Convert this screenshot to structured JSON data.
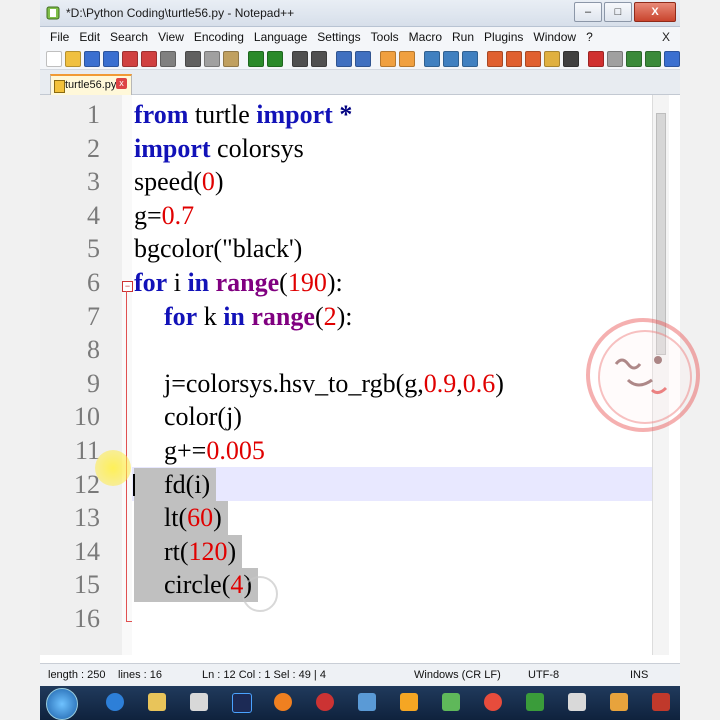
{
  "window": {
    "title": "*D:\\Python Coding\\turtle56.py - Notepad++",
    "min_label": "–",
    "max_label": "□",
    "close_label": "X"
  },
  "menu": {
    "items": [
      "File",
      "Edit",
      "Search",
      "View",
      "Encoding",
      "Language",
      "Settings",
      "Tools",
      "Macro",
      "Run",
      "Plugins",
      "Window",
      "?"
    ],
    "close": "X"
  },
  "tab": {
    "name": "turtle56.py",
    "close": "x"
  },
  "editor": {
    "lines": [
      {
        "n": "1",
        "indent": 0,
        "tokens": [
          {
            "t": "from",
            "c": "kw"
          },
          {
            "t": " turtle ",
            "c": ""
          },
          {
            "t": "import",
            "c": "kw"
          },
          {
            "t": " ",
            "c": ""
          },
          {
            "t": "*",
            "c": "op"
          }
        ]
      },
      {
        "n": "2",
        "indent": 0,
        "tokens": [
          {
            "t": "import",
            "c": "kw"
          },
          {
            "t": " colorsys",
            "c": ""
          }
        ]
      },
      {
        "n": "3",
        "indent": 0,
        "tokens": [
          {
            "t": "speed(",
            "c": ""
          },
          {
            "t": "0",
            "c": "num"
          },
          {
            "t": ")",
            "c": ""
          }
        ]
      },
      {
        "n": "4",
        "indent": 0,
        "tokens": [
          {
            "t": "g=",
            "c": ""
          },
          {
            "t": "0.7",
            "c": "num"
          }
        ]
      },
      {
        "n": "5",
        "indent": 0,
        "tokens": [
          {
            "t": "bgcolor(\"black')",
            "c": ""
          }
        ]
      },
      {
        "n": "6",
        "indent": 0,
        "tokens": [
          {
            "t": "for",
            "c": "kw"
          },
          {
            "t": " i ",
            "c": ""
          },
          {
            "t": "in",
            "c": "kw"
          },
          {
            "t": " ",
            "c": ""
          },
          {
            "t": "range",
            "c": "bi"
          },
          {
            "t": "(",
            "c": ""
          },
          {
            "t": "190",
            "c": "num"
          },
          {
            "t": "):",
            "c": ""
          }
        ]
      },
      {
        "n": "7",
        "indent": 1,
        "tokens": [
          {
            "t": "for",
            "c": "kw"
          },
          {
            "t": " k ",
            "c": ""
          },
          {
            "t": "in",
            "c": "kw"
          },
          {
            "t": " ",
            "c": ""
          },
          {
            "t": "range",
            "c": "bi"
          },
          {
            "t": "(",
            "c": ""
          },
          {
            "t": "2",
            "c": "num"
          },
          {
            "t": "):",
            "c": ""
          }
        ]
      },
      {
        "n": "8",
        "indent": 1,
        "tokens": []
      },
      {
        "n": "9",
        "indent": 1,
        "tokens": [
          {
            "t": "j=colorsys.hsv_to_rgb(g,",
            "c": ""
          },
          {
            "t": "0.9",
            "c": "num"
          },
          {
            "t": ",",
            "c": ""
          },
          {
            "t": "0.6",
            "c": "num"
          },
          {
            "t": ")",
            "c": ""
          }
        ]
      },
      {
        "n": "10",
        "indent": 1,
        "tokens": [
          {
            "t": "color(j)",
            "c": ""
          }
        ]
      },
      {
        "n": "11",
        "indent": 1,
        "tokens": [
          {
            "t": "g+=",
            "c": ""
          },
          {
            "t": "0.005",
            "c": "num"
          }
        ]
      },
      {
        "n": "12",
        "indent": 1,
        "tokens": [
          {
            "t": "fd(i)",
            "c": ""
          }
        ]
      },
      {
        "n": "13",
        "indent": 1,
        "tokens": [
          {
            "t": "lt(",
            "c": ""
          },
          {
            "t": "60",
            "c": "num"
          },
          {
            "t": ")",
            "c": ""
          }
        ]
      },
      {
        "n": "14",
        "indent": 1,
        "tokens": [
          {
            "t": "rt(",
            "c": ""
          },
          {
            "t": "120",
            "c": "num"
          },
          {
            "t": ")",
            "c": ""
          }
        ]
      },
      {
        "n": "15",
        "indent": 1,
        "tokens": [
          {
            "t": "circle(",
            "c": ""
          },
          {
            "t": "4",
            "c": "num"
          },
          {
            "t": ")",
            "c": ""
          }
        ]
      },
      {
        "n": "16",
        "indent": 0,
        "tokens": []
      }
    ],
    "selected_lines": [
      "12",
      "13",
      "14",
      "15"
    ],
    "current_line": "12"
  },
  "status": {
    "length": "length : 250",
    "lines": "lines : 16",
    "position": "Ln : 12    Col : 1    Sel : 49 | 4",
    "eol": "Windows (CR LF)",
    "encoding": "UTF-8",
    "mode": "INS"
  },
  "colors": {
    "keyword": "#1212b8",
    "builtin": "#800080",
    "number": "#e00000",
    "selection": "#c0c0c0",
    "tab_accent": "#f19a35"
  }
}
